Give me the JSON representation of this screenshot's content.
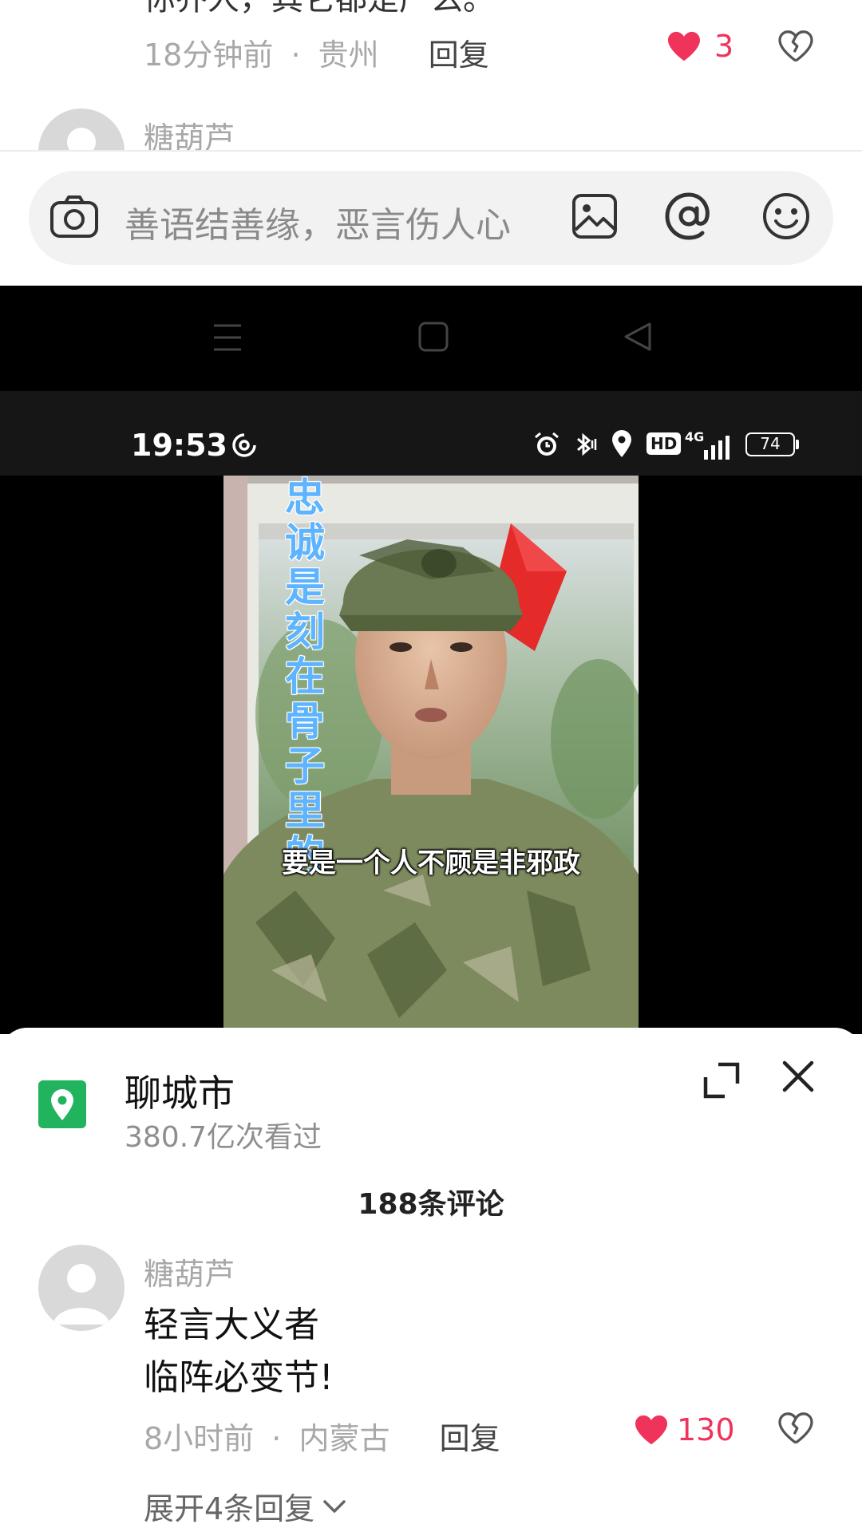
{
  "top_comment": {
    "cut_text": "你乔人，其它都是产么。",
    "time": "18分钟前",
    "location": "贵州",
    "separator": "·",
    "reply_label": "回复",
    "likes": "3"
  },
  "next_comment_preview": {
    "username": "糖葫芦"
  },
  "input": {
    "placeholder": "善语结善缘，恶言伤人心",
    "icons": [
      "camera-icon",
      "image-icon",
      "at-icon",
      "emoji-icon"
    ]
  },
  "status_bar": {
    "time": "19:53",
    "battery": "74",
    "network": "4G",
    "hd": "HD"
  },
  "video": {
    "title_vertical": [
      "忠",
      "诚",
      "是",
      "刻",
      "在",
      "骨",
      "子",
      "里",
      "的"
    ],
    "subtitle": "要是一个人不顾是非邪政"
  },
  "sheet": {
    "location_name": "聊城市",
    "views": "380.7亿次看过",
    "comment_count": "188条评论"
  },
  "main_comment": {
    "username": "糖葫芦",
    "line1": "轻言大义者",
    "line2": "临阵必变节!",
    "time": "8小时前",
    "separator": "·",
    "location": "内蒙古",
    "reply_label": "回复",
    "likes": "130",
    "expand_label": "展开4条回复"
  },
  "colors": {
    "like_red": "#f0335a",
    "location_green": "#22b35e",
    "title_blue": "#5eb4ff"
  }
}
